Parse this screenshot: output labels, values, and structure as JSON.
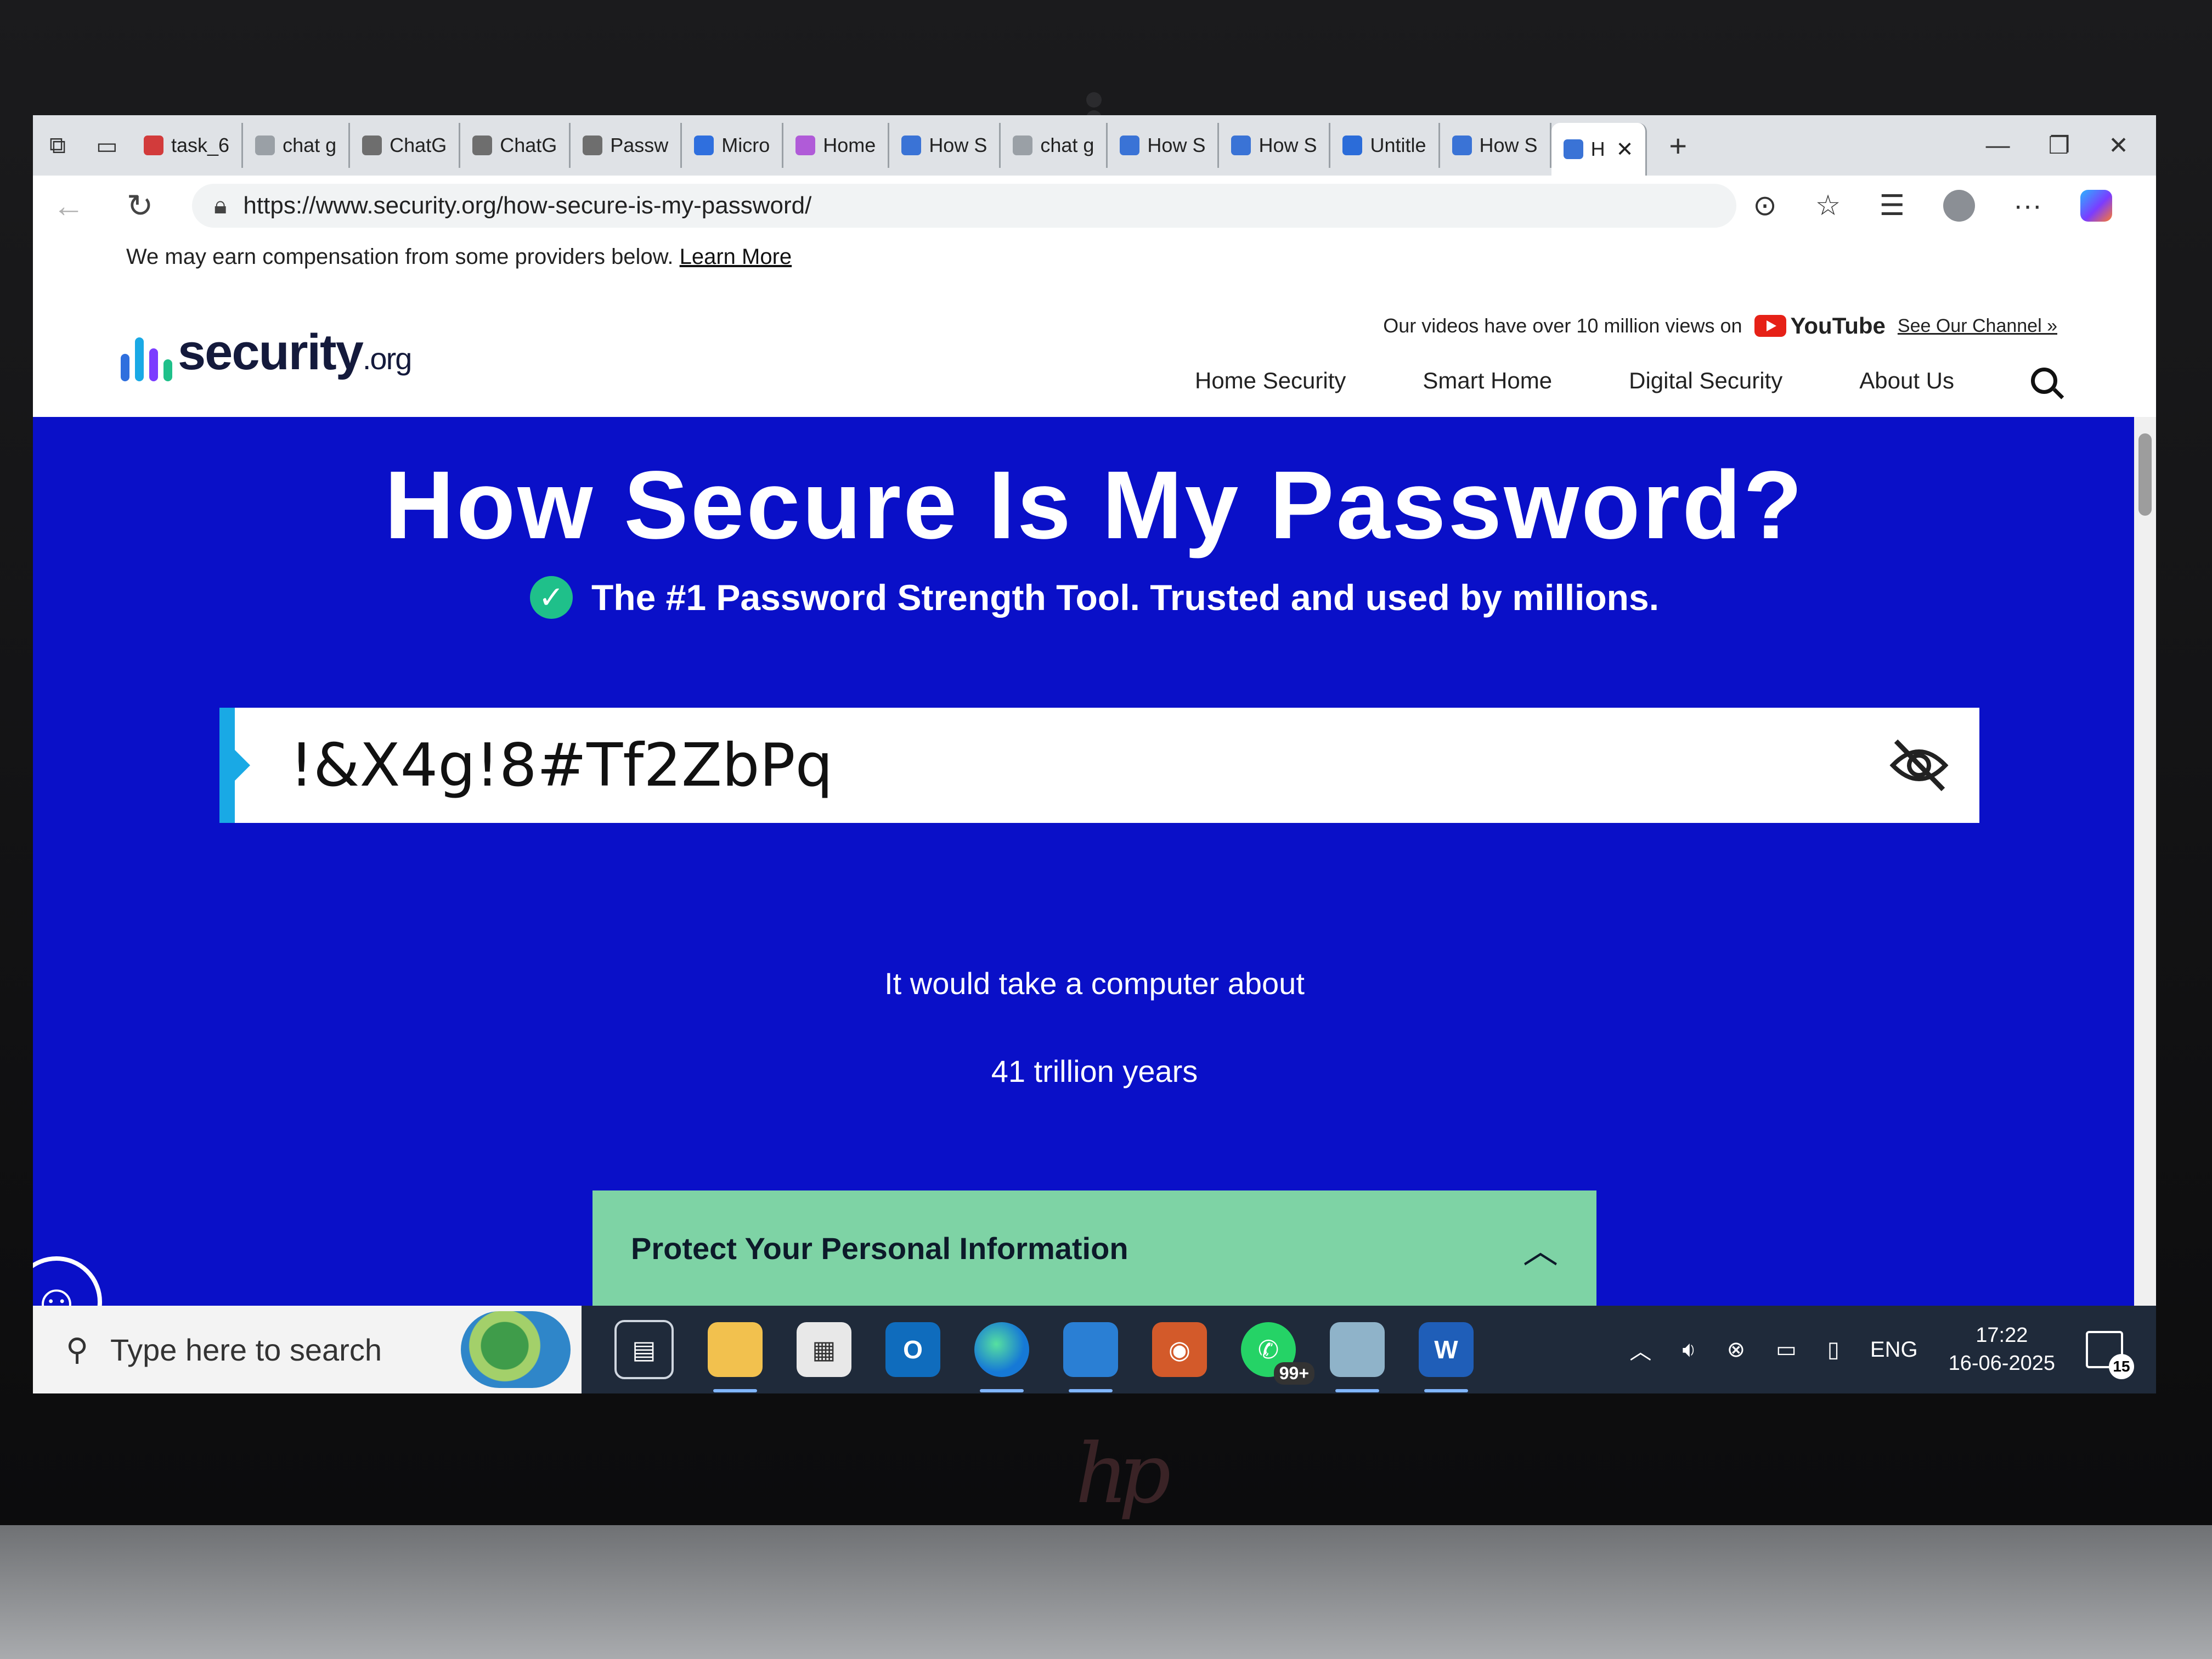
{
  "browser": {
    "tabs": [
      {
        "label": "task_6",
        "fav": "#d23b3b"
      },
      {
        "label": "chat g",
        "fav": "#9aa0a6"
      },
      {
        "label": "ChatG",
        "fav": "#6e6e6e"
      },
      {
        "label": "ChatG",
        "fav": "#6e6e6e"
      },
      {
        "label": "Passw",
        "fav": "#6e6e6e"
      },
      {
        "label": "Micro",
        "fav": "#2f6fde"
      },
      {
        "label": "Home",
        "fav": "#b05bd8"
      },
      {
        "label": "How S",
        "fav": "#3a73d6"
      },
      {
        "label": "chat g",
        "fav": "#9aa0a6"
      },
      {
        "label": "How S",
        "fav": "#3a73d6"
      },
      {
        "label": "How S",
        "fav": "#3a73d6"
      },
      {
        "label": "Untitle",
        "fav": "#2b6cd9"
      },
      {
        "label": "How S",
        "fav": "#3a73d6"
      },
      {
        "label": "H",
        "fav": "#3a73d6",
        "active": true
      }
    ],
    "url": "https://www.security.org/how-secure-is-my-password/",
    "accent": "#2b6cd9"
  },
  "site": {
    "disclaimer": "We may earn compensation from some providers below.",
    "disclaimer_link": "Learn More",
    "logo_text": "security",
    "logo_suffix": ".org",
    "videos_note": "Our videos have over 10 million views on",
    "youtube_label": "YouTube",
    "channel_link": "See Our Channel »",
    "nav": [
      "Home Security",
      "Smart Home",
      "Digital Security",
      "About Us"
    ],
    "colors": {
      "hero_bg": "#0a10c8",
      "input_accent": "#19a9e5",
      "check": "#1fc08a",
      "protect_bar": "#7ed3a5"
    }
  },
  "hero": {
    "title": "How Secure Is My Password?",
    "tagline": "The #1 Password Strength Tool. Trusted and used by millions.",
    "password_value": "!&X4g!8#Tf2ZbPq",
    "result_prefix": "It would take a computer about",
    "result_time": "41 trillion years",
    "protect_title": "Protect Your Personal Information"
  },
  "taskbar": {
    "search_placeholder": "Type here to search",
    "whatsapp_badge": "99+",
    "language": "ENG",
    "time": "17:22",
    "date": "16-06-2025",
    "notifications": "15"
  }
}
